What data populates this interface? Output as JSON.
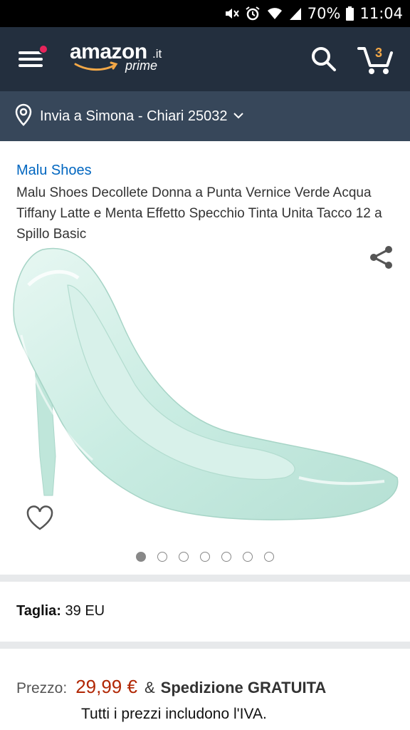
{
  "status": {
    "battery": "70%",
    "time": "11:04"
  },
  "header": {
    "logo_word": "amazon",
    "logo_tld": ".it",
    "logo_prime": "prime",
    "cart_count": "3"
  },
  "delivery": {
    "text": "Invia a Simona - Chiari 25032"
  },
  "product": {
    "brand": "Malu Shoes",
    "title": "Malu Shoes Decollete Donna a Punta Vernice Verde Acqua Tiffany Latte e Menta Effetto Specchio Tinta Unita Tacco 12 a Spillo Basic",
    "images_count": 7,
    "active_image": 1
  },
  "size": {
    "label": "Taglia:",
    "value": "39 EU"
  },
  "price": {
    "label": "Prezzo:",
    "value": "29,99 €",
    "amp": "&",
    "shipping": "Spedizione GRATUITA",
    "vat_note": "Tutti i prezzi includono l'IVA."
  },
  "colors": {
    "header": "#232f3e",
    "delivery_bar": "#37475a",
    "brand_link": "#0066c0",
    "price": "#b12704",
    "cart_count": "#f3a847",
    "shoe": "#cdeee4"
  }
}
